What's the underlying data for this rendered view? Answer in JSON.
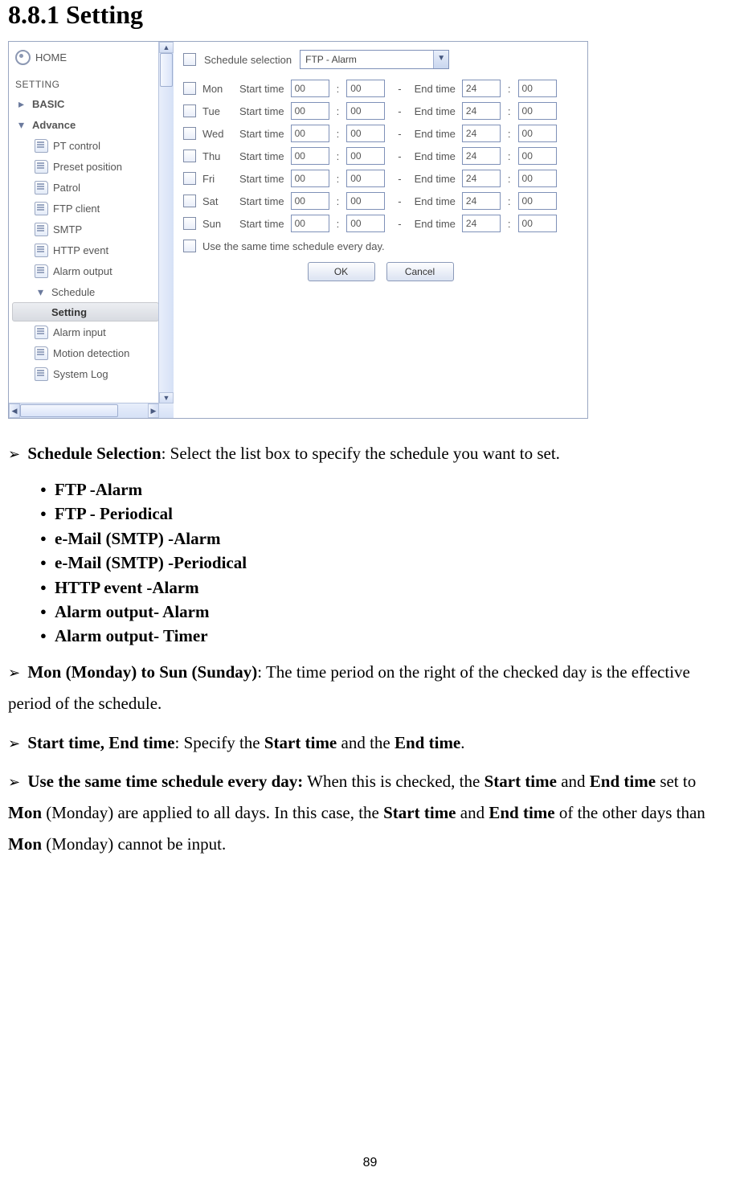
{
  "heading": "8.8.1 Setting",
  "sidebar": {
    "home": "HOME",
    "section": "SETTING",
    "basic": "BASIC",
    "advance": "Advance",
    "items": {
      "pt": "PT control",
      "preset": "Preset position",
      "patrol": "Patrol",
      "ftp": "FTP client",
      "smtp": "SMTP",
      "http": "HTTP event",
      "alarmout": "Alarm output",
      "schedule": "Schedule",
      "setting": "Setting",
      "alarmin": "Alarm input",
      "motion": "Motion detection",
      "syslog": "System Log"
    }
  },
  "content": {
    "schedule_selection_label": "Schedule selection",
    "schedule_selection_value": "FTP - Alarm",
    "start_label": "Start time",
    "end_label": "End time",
    "same_day": "Use the same time schedule every day.",
    "ok": "OK",
    "cancel": "Cancel",
    "days": {
      "mon": {
        "label": "Mon",
        "s_h": "00",
        "s_m": "00",
        "e_h": "24",
        "e_m": "00"
      },
      "tue": {
        "label": "Tue",
        "s_h": "00",
        "s_m": "00",
        "e_h": "24",
        "e_m": "00"
      },
      "wed": {
        "label": "Wed",
        "s_h": "00",
        "s_m": "00",
        "e_h": "24",
        "e_m": "00"
      },
      "thu": {
        "label": "Thu",
        "s_h": "00",
        "s_m": "00",
        "e_h": "24",
        "e_m": "00"
      },
      "fri": {
        "label": "Fri",
        "s_h": "00",
        "s_m": "00",
        "e_h": "24",
        "e_m": "00"
      },
      "sat": {
        "label": "Sat",
        "s_h": "00",
        "s_m": "00",
        "e_h": "24",
        "e_m": "00"
      },
      "sun": {
        "label": "Sun",
        "s_h": "00",
        "s_m": "00",
        "e_h": "24",
        "e_m": "00"
      }
    }
  },
  "doc": {
    "sched_sel_bold": "Schedule Selection",
    "sched_sel_rest": ": Select the list box to specify the schedule you want to set.",
    "options": [
      "FTP -Alarm",
      "FTP - Periodical",
      "e-Mail (SMTP) -Alarm",
      "e-Mail (SMTP) -Periodical",
      "HTTP event -Alarm",
      "Alarm output- Alarm",
      "Alarm output- Timer"
    ],
    "mon_sun_bold": "Mon (Monday) to Sun (Sunday)",
    "mon_sun_rest": ": The time period on the right of the checked day is the effective period of the schedule.",
    "start_end_bold": "Start time, End time",
    "start_end_mid1": ": Specify the ",
    "start_end_b1": "Start time",
    "start_end_mid2": " and the ",
    "start_end_b2": "End time",
    "start_end_end": ".",
    "same_bold": "Use the same time schedule every day:",
    "same_t1": " When this is checked, the ",
    "same_b1": "Start time",
    "same_t2": " and ",
    "same_b2": "End time",
    "same_t3": " set to ",
    "same_b3": "Mon",
    "same_t4": " (Monday) are applied to all days. In this case, the ",
    "same_b4": "Start time",
    "same_t5": " and ",
    "same_b5": "End time",
    "same_t6": " of the other days than ",
    "same_b6": "Mon",
    "same_t7": " (Monday) cannot be input."
  },
  "page_number": "89"
}
